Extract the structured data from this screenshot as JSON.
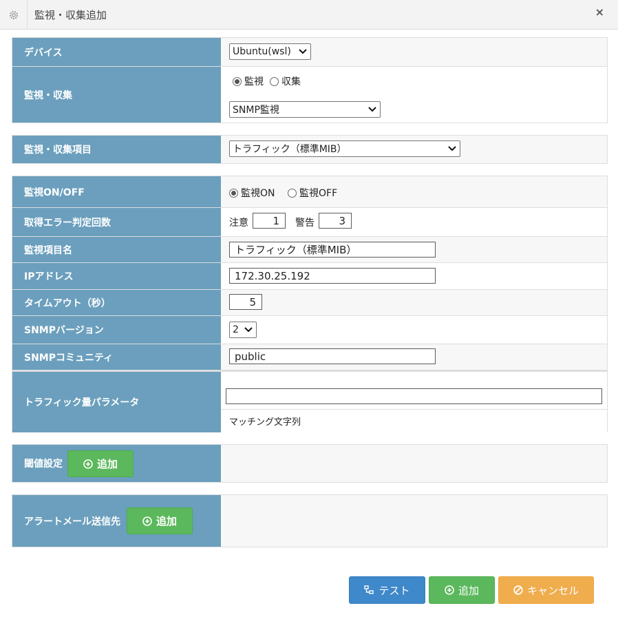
{
  "dialog": {
    "title": "監視・収集追加"
  },
  "device": {
    "label": "デバイス",
    "value": "Ubuntu(wsl)"
  },
  "mode": {
    "label": "監視・収集",
    "option_monitor": "監視",
    "option_collect": "収集",
    "selected": "監視",
    "type_value": "SNMP監視"
  },
  "item": {
    "label": "監視・収集項目",
    "value": "トラフィック（標準MIB）"
  },
  "monitor_onoff": {
    "label": "監視ON/OFF",
    "option_on": "監視ON",
    "option_off": "監視OFF",
    "selected": "監視ON"
  },
  "error_count": {
    "label": "取得エラー判定回数",
    "caution_label": "注意",
    "caution_value": "1",
    "warning_label": "警告",
    "warning_value": "3"
  },
  "item_name": {
    "label": "監視項目名",
    "value": "トラフィック（標準MIB）"
  },
  "ip": {
    "label": "IPアドレス",
    "value": "172.30.25.192"
  },
  "timeout": {
    "label": "タイムアウト（秒）",
    "value": "5"
  },
  "snmp_version": {
    "label": "SNMPバージョン",
    "value": "2"
  },
  "snmp_community": {
    "label": "SNMPコミュニティ",
    "value": "public"
  },
  "traffic_param": {
    "label": "トラフィック量パラメータ",
    "value": "",
    "hint": "マッチング文字列"
  },
  "threshold": {
    "label": "閾値設定",
    "add_button": "追加"
  },
  "alert_mail": {
    "label": "アラートメール送信先",
    "add_button": "追加"
  },
  "footer": {
    "test_button": "テスト",
    "add_button": "追加",
    "cancel_button": "キャンセル"
  },
  "colors": {
    "label_bg": "#6b9fbd",
    "green": "#5cb85c",
    "blue": "#3f88c9",
    "orange": "#f0ad4e"
  },
  "icons": {
    "header": "gear-icon",
    "close": "close-icon",
    "add": "plus-circle-icon",
    "test": "sitemap-icon",
    "cancel": "ban-icon"
  }
}
